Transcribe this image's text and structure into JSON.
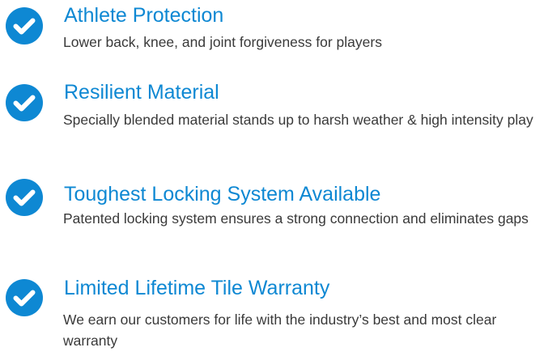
{
  "colors": {
    "accent": "#0e88d3",
    "text": "#3a3a3a"
  },
  "icon": "check-circle-icon",
  "features": [
    {
      "title": "Athlete Protection",
      "description": "Lower back, knee, and joint forgiveness for players"
    },
    {
      "title": "Resilient Material",
      "description": "Specially blended material stands up to harsh weather & high intensity play"
    },
    {
      "title": "Toughest Locking System Available",
      "description": "Patented locking system ensures a strong connection and eliminates gaps"
    },
    {
      "title": "Limited Lifetime Tile Warranty",
      "description": "We earn our customers for life with the industry’s best and most clear warranty"
    }
  ]
}
